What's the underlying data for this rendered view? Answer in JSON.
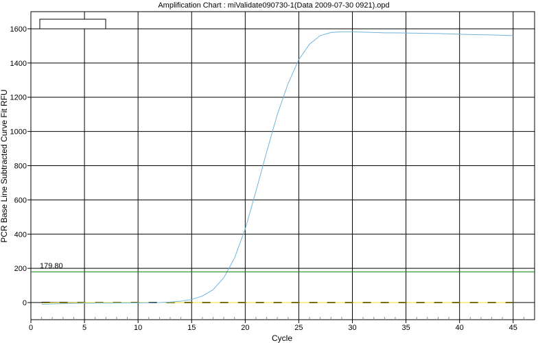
{
  "chart_data": {
    "type": "line",
    "title": "Amplification Chart : miValidate090730-1(Data 2009-07-30 0921).opd",
    "xlabel": "Cycle",
    "ylabel": "PCR Base Line Subtracted Curve Fit RFU",
    "xlim": [
      0,
      47
    ],
    "ylim": [
      -100,
      1700
    ],
    "x_ticks": [
      0,
      5,
      10,
      15,
      20,
      25,
      30,
      35,
      40,
      45
    ],
    "x_tick_labels": [
      "0",
      "5",
      "10",
      "15",
      "20",
      "25",
      "30",
      "35",
      "40",
      "45"
    ],
    "y_ticks": [
      0,
      200,
      400,
      600,
      800,
      1000,
      1200,
      1400,
      1600
    ],
    "y_tick_labels": [
      "0",
      "200",
      "400",
      "600",
      "800",
      "1000",
      "1200",
      "1400",
      "1600"
    ],
    "grid": true,
    "legend": {
      "placement": "top-left",
      "entries": []
    },
    "threshold": {
      "value": 179.8,
      "label": "179.80",
      "color": "#008000"
    },
    "series": [
      {
        "color": "#6EB4E0",
        "x": [
          1,
          2,
          3,
          4,
          5,
          6,
          7,
          8,
          9,
          10,
          11,
          12,
          13,
          14,
          15,
          16,
          17,
          18,
          19,
          20,
          21,
          22,
          23,
          24,
          25,
          26,
          27,
          28,
          29,
          30,
          31,
          32,
          33,
          34,
          35,
          36,
          37,
          38,
          39,
          40,
          41,
          42,
          43,
          44,
          45
        ],
        "values": [
          -10,
          -8,
          -6,
          -5,
          -4,
          -3,
          -3,
          -3,
          -2,
          -2,
          -1,
          0,
          3,
          8,
          18,
          38,
          75,
          145,
          260,
          430,
          650,
          880,
          1100,
          1280,
          1420,
          1510,
          1560,
          1578,
          1582,
          1582,
          1580,
          1578,
          1576,
          1576,
          1575,
          1574,
          1573,
          1572,
          1570,
          1568,
          1566,
          1565,
          1564,
          1562,
          1560
        ]
      },
      {
        "color": "#F0E020",
        "x": [
          1,
          2,
          3,
          4,
          5,
          6,
          7,
          8,
          9,
          10,
          11,
          12,
          13,
          14,
          15,
          16,
          17,
          18,
          19,
          20,
          21,
          22,
          23,
          24,
          25,
          26,
          27,
          28,
          29,
          30,
          31,
          32,
          33,
          34,
          35,
          36,
          37,
          38,
          39,
          40,
          41,
          42,
          43,
          44,
          45
        ],
        "values": [
          -3,
          -2,
          -1,
          -1,
          0,
          0,
          0,
          0,
          0,
          0,
          0,
          0,
          0,
          0,
          0,
          0,
          0,
          0,
          0,
          0,
          0,
          0,
          0,
          0,
          0,
          0,
          0,
          0,
          0,
          0,
          0,
          0,
          0,
          0,
          0,
          0,
          0,
          0,
          0,
          0,
          0,
          0,
          0,
          0,
          0
        ]
      },
      {
        "color": "#000000",
        "dash": true,
        "x": [
          1,
          2,
          3,
          4,
          5,
          6,
          7,
          8,
          9,
          10,
          11,
          12,
          13,
          14,
          15,
          16,
          17,
          18,
          19,
          20,
          21,
          22,
          23,
          24,
          25,
          26,
          27,
          28,
          29,
          30,
          31,
          32,
          33,
          34,
          35,
          36,
          37,
          38,
          39,
          40,
          41,
          42,
          43,
          44,
          45
        ],
        "values": [
          0,
          0,
          0,
          0,
          0,
          0,
          0,
          0,
          0,
          0,
          0,
          0,
          0,
          0,
          0,
          0,
          0,
          0,
          0,
          0,
          0,
          0,
          0,
          0,
          0,
          0,
          0,
          0,
          0,
          0,
          0,
          0,
          0,
          0,
          0,
          0,
          0,
          0,
          0,
          0,
          0,
          0,
          0,
          0,
          0
        ]
      }
    ]
  }
}
